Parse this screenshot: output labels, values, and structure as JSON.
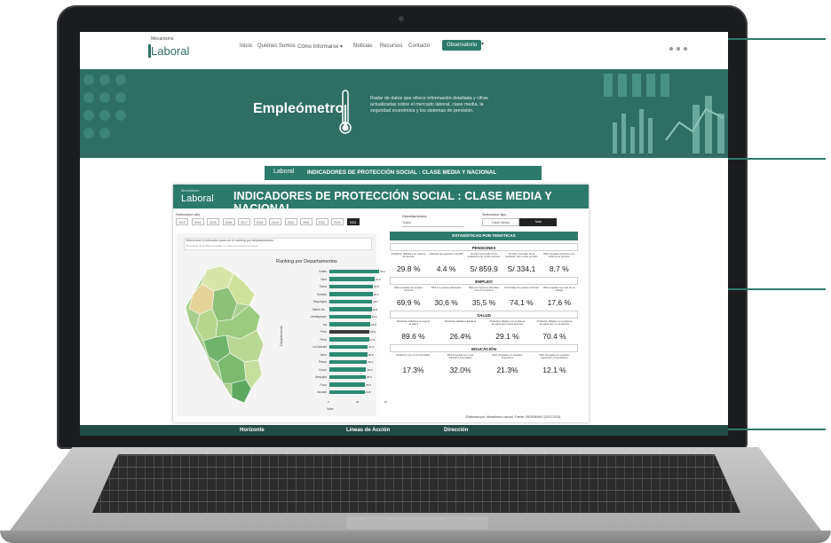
{
  "site": {
    "logo_small": "Mecanismo",
    "logo": "Laboral",
    "nav": [
      "Inicio",
      "Quiénes Somos",
      "Cómo Informarse ▾",
      "Noticias",
      "Recursos",
      "Contacto"
    ],
    "nav_button": "Observatorio",
    "nav_caret": "▾"
  },
  "hero": {
    "title": "Empleómetro",
    "description": "Radar de datos que ofrece información detallada y cifras actualizadas sobre el mercado laboral, clase media, la seguridad económica y los sistemas de previsión.",
    "thermometer_icon": "thermometer-icon"
  },
  "banner": {
    "logo": "Laboral",
    "title": "INDICADORES DE PROTECCIÓN SOCIAL : CLASE MEDIA Y NACIONAL"
  },
  "dashboard": {
    "logo_small": "Mecanismo",
    "logo": "Laboral",
    "title": "INDICADORES DE PROTECCIÓN SOCIAL : CLASE MEDIA Y NACIONAL",
    "year_label": "Seleccione año",
    "years": [
      "2013",
      "2014",
      "2015",
      "2016",
      "2017",
      "2018",
      "2019",
      "2020",
      "2021",
      "2022",
      "2023",
      "2024"
    ],
    "selected_year": "2024",
    "department_label": "Departamentos",
    "department_value": "Todos",
    "type_label": "Seleccione tipo",
    "type_options": [
      "Clase Media",
      "Total"
    ],
    "selected_type": "Total",
    "select_indicator_title": "Seleccione el indicador para ver el ranking por departamentos",
    "select_indicator_value": "Porcentaje de la PEA ocupada con años de estudio completo",
    "ranking_title": "Ranking por Departamentos",
    "footnote": "Elaborado por: Mecanismo Laboral. Fuente: INEI/ENAHO (2013-2024)."
  },
  "chart_data": {
    "type": "bar",
    "title": "Ranking por Departamentos",
    "xlabel": "Valor",
    "ylabel": "Departamento",
    "categories": [
      "Callao",
      "Lima",
      "Tacna",
      "Tumbes",
      "Moquegua",
      "Madre de...",
      "Lambayeque",
      "Ica",
      "Perú",
      "Piura",
      "La Libertad",
      "Junín",
      "Pasco",
      "Cusco",
      "Arequipa",
      "Puno",
      "Ancash"
    ],
    "values": [
      35.1,
      32.0,
      30.8,
      30.5,
      30.2,
      29.8,
      29.2,
      28.8,
      28.3,
      27.9,
      27.2,
      26.8,
      26.4,
      26.0,
      25.6,
      25.2,
      24.8
    ],
    "highlight": "Perú",
    "xlim": [
      0,
      40
    ],
    "xticks": [
      0,
      20,
      40
    ],
    "bar_color": "#2c8a73",
    "highlight_color": "#3b3b3b"
  },
  "stats": {
    "header": "ESTADÍSTICAS POR TEMÁTICAS",
    "sections": [
      {
        "name": "PENSIONES",
        "items": [
          {
            "desc": "Población afiliada a un sistema de pensión",
            "value": "29.8 %"
          },
          {
            "desc": "Afiliados que aportan a la AFP",
            "value": "4.4 %"
          },
          {
            "desc": "Pensión promedio de la población que recibe pensión",
            "value": "S/ 859,9"
          },
          {
            "desc": "Pensión promedio de la población que recibe pensión",
            "value": "S/ 334,1"
          },
          {
            "desc": "PEA ocupada cotizante a un sistema de pensión",
            "value": "8,7 %"
          }
        ]
      },
      {
        "name": "EMPLEO",
        "items": [
          {
            "desc": "PEA ocupada con empleo informal",
            "value": "69,9 %"
          },
          {
            "desc": "PEA con empleo adecuado",
            "value": "30,6 %"
          },
          {
            "desc": "PEA con ingresos laborales menor al mínimo",
            "value": "35,5 %"
          },
          {
            "desc": "Porcentaje de empleo informal",
            "value": "74,1 %"
          },
          {
            "desc": "PEA ocupada con más de un trabajo",
            "value": "17,6 %"
          }
        ]
      },
      {
        "name": "SALUD",
        "items": [
          {
            "desc": "Población afiliada a un seguro de salud",
            "value": "89.6 %"
          },
          {
            "desc": "Población afiliada a EsSalud",
            "value": "26.4%"
          },
          {
            "desc": "Población afiliada con problema de salud que busca atención",
            "value": "29.1 %"
          },
          {
            "desc": "Población afiliada con problema de salud que no se atendió",
            "value": "70.4 %"
          }
        ]
      },
      {
        "name": "EDUCACIÓN",
        "items": [
          {
            "desc": "Población que no ha estudiado",
            "value": "17.3%"
          },
          {
            "desc": "PEA Ocupada con nivel educativo secundario",
            "value": "32.0%"
          },
          {
            "desc": "PEA Ocupada con estudios superiores",
            "value": "21.3%"
          },
          {
            "desc": "PEA Ocupada con estudios superiores universitarios",
            "value": "12.1 %"
          }
        ]
      }
    ]
  },
  "footer": [
    "Horizonte",
    "Líneas de Acción",
    "Dirección"
  ],
  "colors": {
    "brand": "#2c7a6a",
    "hero": "#2e6e63",
    "footer": "#244c46"
  }
}
